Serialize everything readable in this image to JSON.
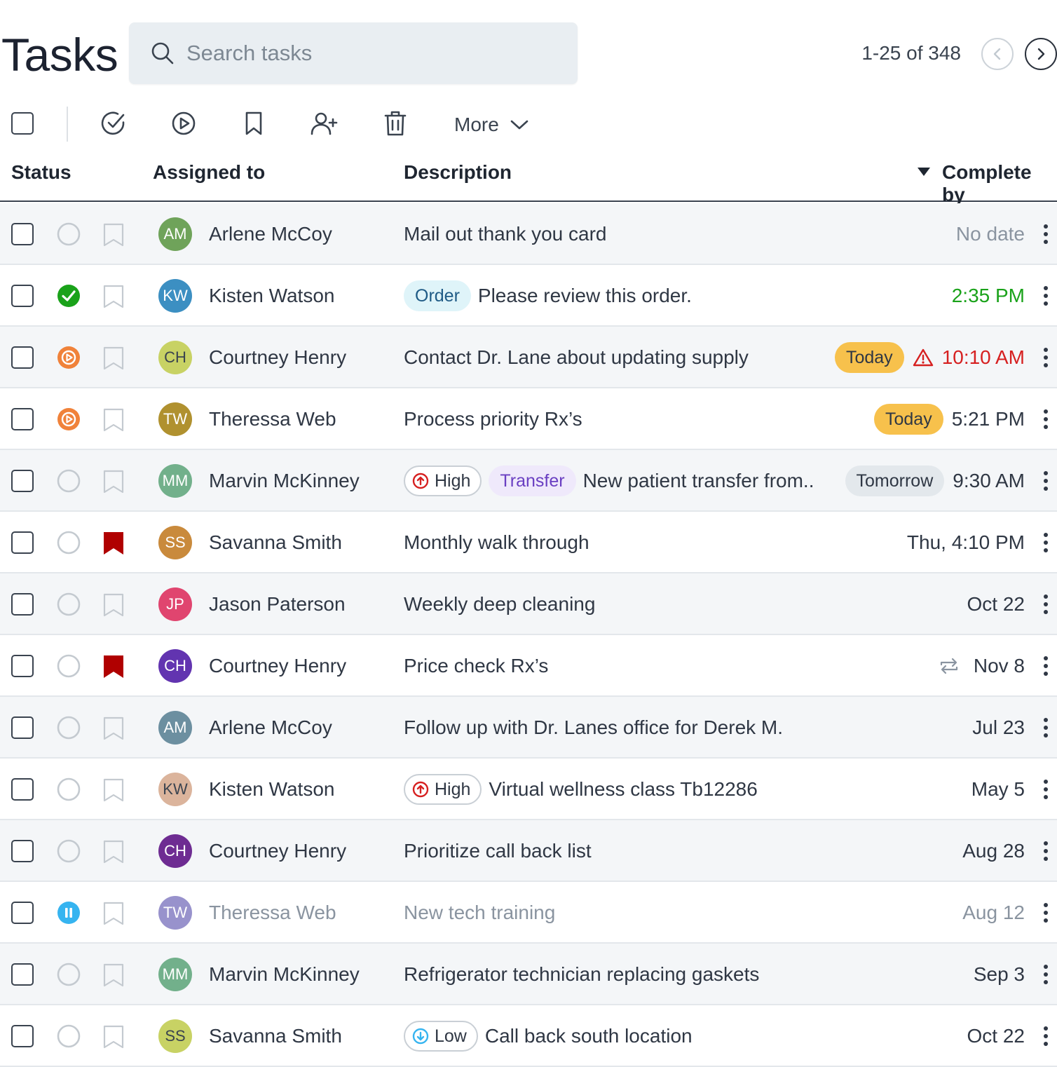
{
  "header": {
    "title": "Tasks",
    "search_placeholder": "Search tasks",
    "pagination": "1-25 of 348"
  },
  "toolbar": {
    "more_label": "More",
    "icons": [
      "check-circle-icon",
      "play-circle-icon",
      "bookmark-icon",
      "add-user-icon",
      "trash-icon"
    ]
  },
  "columns": {
    "status": "Status",
    "assigned": "Assigned to",
    "description": "Description",
    "complete_by": "Complete by"
  },
  "colors": {
    "green": "#1aa21a",
    "orange": "#f0823a",
    "blue": "#36b4f0",
    "red": "#d62020",
    "flag_red": "#b00000",
    "today": "#f7c14c"
  },
  "rows": [
    {
      "status": "open",
      "flagged": false,
      "initials": "AM",
      "avatar_color": "#6fa35a",
      "name": "Arlene McCoy",
      "tags": [],
      "desc": "Mail out thank you card",
      "due_tag": "",
      "due": "No date",
      "due_color": "#8a94a0"
    },
    {
      "status": "done",
      "flagged": false,
      "initials": "KW",
      "avatar_color": "#3c8fc2",
      "name": "Kisten Watson",
      "tags": [
        {
          "type": "order",
          "label": "Order"
        }
      ],
      "desc": "Please review this order.",
      "due_tag": "",
      "due": "2:35 PM",
      "due_color": "#1aa21a"
    },
    {
      "status": "in-progress",
      "flagged": false,
      "initials": "CH",
      "avatar_color": "#c8d264",
      "avatar_text": "#3a434f",
      "name": "Courtney Henry",
      "tags": [],
      "desc": "Contact Dr. Lane about updating supply",
      "due_tag": "Today",
      "warn": true,
      "due": "10:10 AM",
      "due_color": "#d62020"
    },
    {
      "status": "in-progress",
      "flagged": false,
      "initials": "TW",
      "avatar_color": "#b0912f",
      "name": "Theressa Web",
      "tags": [],
      "desc": "Process priority Rx’s",
      "due_tag": "Today",
      "due": "5:21 PM",
      "due_color": "#2f3744"
    },
    {
      "status": "open",
      "flagged": false,
      "initials": "MM",
      "avatar_color": "#72b08b",
      "name": "Marvin McKinney",
      "tags": [
        {
          "type": "high",
          "label": "High"
        },
        {
          "type": "transfer",
          "label": "Transfer"
        }
      ],
      "desc": "New patient transfer from..",
      "due_tag": "Tomorrow",
      "due": "9:30 AM",
      "due_color": "#2f3744"
    },
    {
      "status": "open",
      "flagged": true,
      "initials": "SS",
      "avatar_color": "#c98a3c",
      "name": "Savanna Smith",
      "tags": [],
      "desc": "Monthly walk through",
      "due_tag": "",
      "due": "Thu, 4:10 PM",
      "due_color": "#2f3744"
    },
    {
      "status": "open",
      "flagged": false,
      "initials": "JP",
      "avatar_color": "#e0456f",
      "name": "Jason Paterson",
      "tags": [],
      "desc": "Weekly deep cleaning",
      "due_tag": "",
      "due": "Oct 22",
      "due_color": "#2f3744"
    },
    {
      "status": "open",
      "flagged": true,
      "initials": "CH",
      "avatar_color": "#6234b0",
      "name": "Courtney Henry",
      "tags": [],
      "desc": "Price check Rx’s",
      "due_tag": "",
      "repeat": true,
      "due": "Nov 8",
      "due_color": "#2f3744"
    },
    {
      "status": "open",
      "flagged": false,
      "initials": "AM",
      "avatar_color": "#6c8fa0",
      "name": "Arlene McCoy",
      "tags": [],
      "desc": "Follow up with Dr. Lanes office for Derek M.",
      "due_tag": "",
      "due": "Jul 23",
      "due_color": "#2f3744"
    },
    {
      "status": "open",
      "flagged": false,
      "initials": "KW",
      "avatar_color": "#dbb49c",
      "avatar_text": "#3a434f",
      "name": "Kisten Watson",
      "tags": [
        {
          "type": "high",
          "label": "High"
        }
      ],
      "desc": "Virtual wellness class Tb12286",
      "due_tag": "",
      "due": "May 5",
      "due_color": "#2f3744"
    },
    {
      "status": "open",
      "flagged": false,
      "initials": "CH",
      "avatar_color": "#6e2c92",
      "name": "Courtney Henry",
      "tags": [],
      "desc": "Prioritize call back list",
      "due_tag": "",
      "due": "Aug 28",
      "due_color": "#2f3744"
    },
    {
      "status": "paused",
      "flagged": false,
      "muted": true,
      "initials": "TW",
      "avatar_color": "#9892cc",
      "name": "Theressa Web",
      "tags": [],
      "desc": "New tech training",
      "due_tag": "",
      "due": "Aug 12",
      "due_color": "#8a94a0"
    },
    {
      "status": "open",
      "flagged": false,
      "initials": "MM",
      "avatar_color": "#72b08b",
      "name": "Marvin McKinney",
      "tags": [],
      "desc": "Refrigerator technician replacing gaskets",
      "due_tag": "",
      "due": "Sep 3",
      "due_color": "#2f3744"
    },
    {
      "status": "open",
      "flagged": false,
      "initials": "SS",
      "avatar_color": "#c8d264",
      "avatar_text": "#3a434f",
      "name": "Savanna Smith",
      "tags": [
        {
          "type": "low",
          "label": "Low"
        }
      ],
      "desc": "Call back south location",
      "due_tag": "",
      "due": "Oct 22",
      "due_color": "#2f3744"
    }
  ]
}
